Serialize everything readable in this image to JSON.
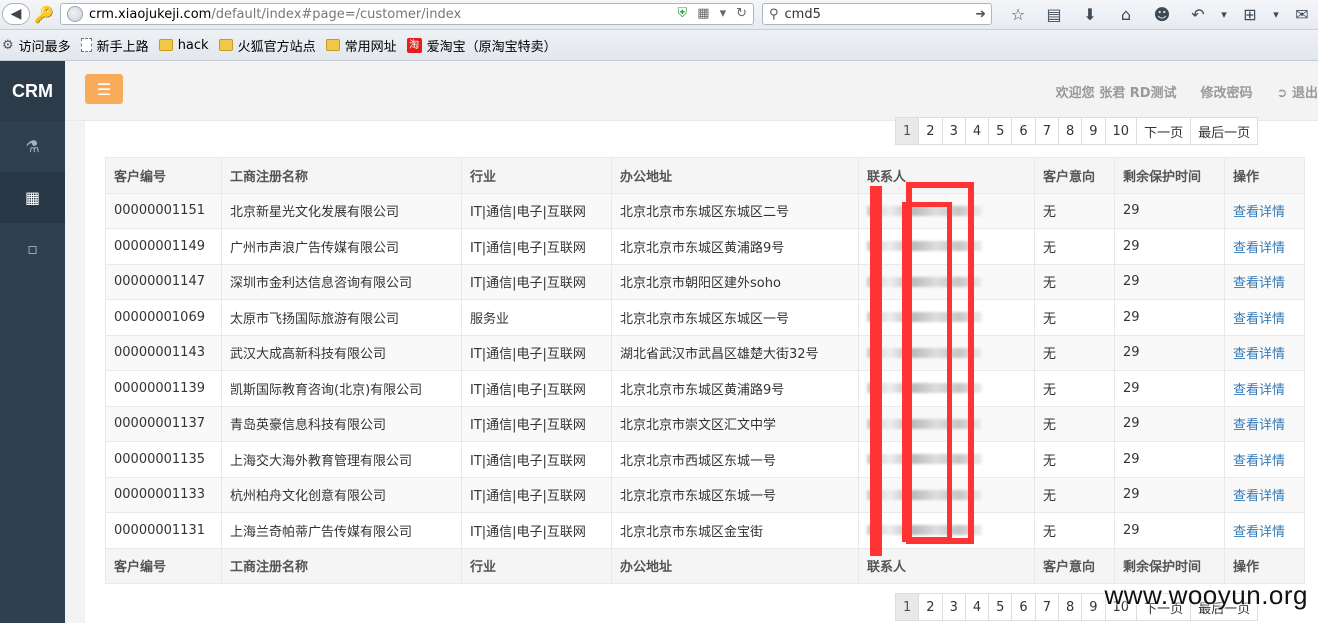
{
  "browser": {
    "url_host": "crm.xiaojukeji.com",
    "url_path": "/default/index#page=/customer/index",
    "search_value": "cmd5",
    "bookmarks": [
      "访问最多",
      "新手上路",
      "hack",
      "火狐官方站点",
      "常用网址",
      "爱淘宝（原淘宝特卖）"
    ],
    "taobao_badge": "淘"
  },
  "app": {
    "brand": "CRM",
    "welcome": "欢迎您 张君 RD测试",
    "change_password": "修改密码",
    "logout": "退出",
    "sidebar_icons": [
      "flask-icon",
      "grid-icon",
      "bar-chart-icon"
    ]
  },
  "pagination": {
    "pages": [
      "1",
      "2",
      "3",
      "4",
      "5",
      "6",
      "7",
      "8",
      "9",
      "10"
    ],
    "active": "1",
    "next": "下一页",
    "last": "最后一页"
  },
  "table": {
    "headers": [
      "客户编号",
      "工商注册名称",
      "行业",
      "办公地址",
      "联系人",
      "客户意向",
      "剩余保护时间",
      "操作"
    ],
    "rows": [
      {
        "id": "00000001151",
        "name": "北京新星光文化发展有限公司",
        "industry": "IT|通信|电子|互联网",
        "address": "北京北京市东城区东城区二号",
        "intent": "无",
        "remaining": "29",
        "action": "查看详情"
      },
      {
        "id": "00000001149",
        "name": "广州市声浪广告传媒有限公司",
        "industry": "IT|通信|电子|互联网",
        "address": "北京北京市东城区黄浦路9号",
        "intent": "无",
        "remaining": "29",
        "action": "查看详情"
      },
      {
        "id": "00000001147",
        "name": "深圳市金利达信息咨询有限公司",
        "industry": "IT|通信|电子|互联网",
        "address": "北京北京市朝阳区建外soho",
        "intent": "无",
        "remaining": "29",
        "action": "查看详情"
      },
      {
        "id": "00000001069",
        "name": "太原市飞扬国际旅游有限公司",
        "industry": "服务业",
        "address": "北京北京市东城区东城区一号",
        "intent": "无",
        "remaining": "29",
        "action": "查看详情"
      },
      {
        "id": "00000001143",
        "name": "武汉大成高新科技有限公司",
        "industry": "IT|通信|电子|互联网",
        "address": "湖北省武汉市武昌区雄楚大街32号",
        "intent": "无",
        "remaining": "29",
        "action": "查看详情"
      },
      {
        "id": "00000001139",
        "name": "凯斯国际教育咨询(北京)有限公司",
        "industry": "IT|通信|电子|互联网",
        "address": "北京北京市东城区黄浦路9号",
        "intent": "无",
        "remaining": "29",
        "action": "查看详情"
      },
      {
        "id": "00000001137",
        "name": "青岛英豪信息科技有限公司",
        "industry": "IT|通信|电子|互联网",
        "address": "北京北京市崇文区汇文中学",
        "intent": "无",
        "remaining": "29",
        "action": "查看详情"
      },
      {
        "id": "00000001135",
        "name": "上海交大海外教育管理有限公司",
        "industry": "IT|通信|电子|互联网",
        "address": "北京北京市西城区东城一号",
        "intent": "无",
        "remaining": "29",
        "action": "查看详情"
      },
      {
        "id": "00000001133",
        "name": "杭州柏舟文化创意有限公司",
        "industry": "IT|通信|电子|互联网",
        "address": "北京北京市东城区东城一号",
        "intent": "无",
        "remaining": "29",
        "action": "查看详情"
      },
      {
        "id": "00000001131",
        "name": "上海兰奇帕蒂广告传媒有限公司",
        "industry": "IT|通信|电子|互联网",
        "address": "北京北京市东城区金宝街",
        "intent": "无",
        "remaining": "29",
        "action": "查看详情"
      }
    ]
  },
  "watermark": "www.wooyun.org",
  "colors": {
    "sidebar": "#2f4050",
    "accent": "#f8ac59",
    "link": "#337ab7",
    "annotation": "#ff3333"
  }
}
